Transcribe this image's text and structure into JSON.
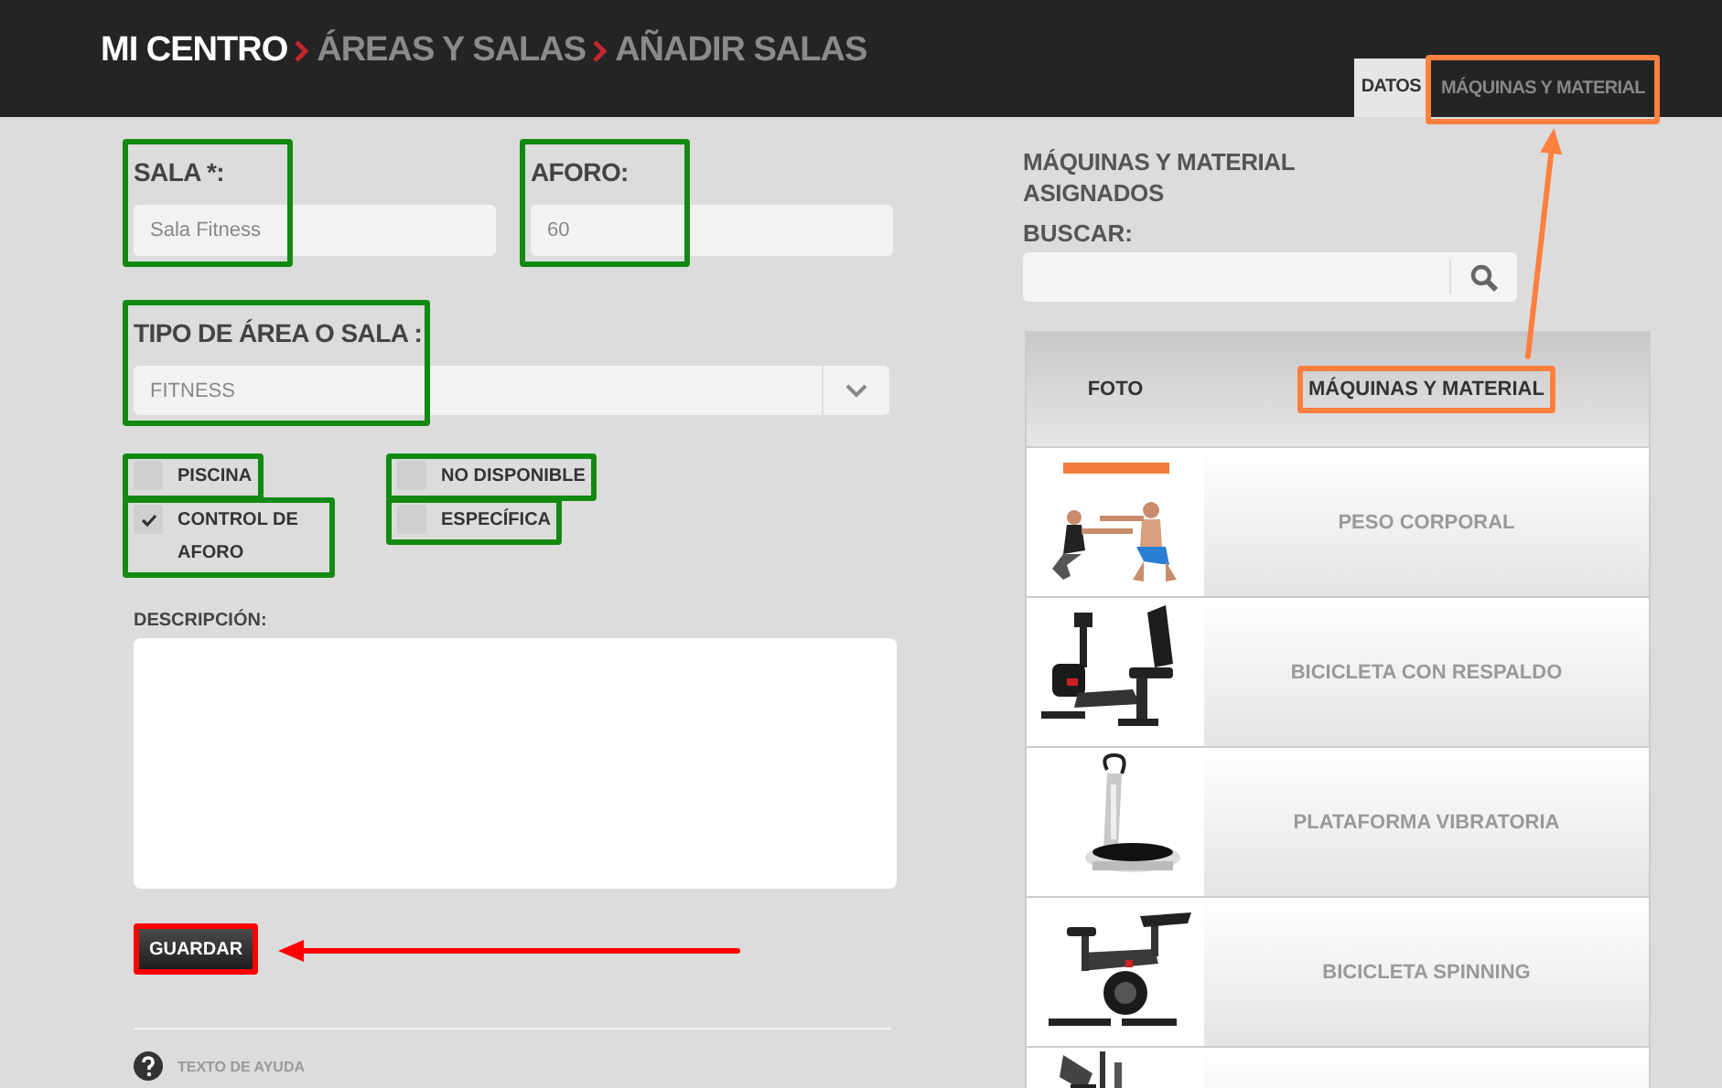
{
  "header": {
    "breadcrumb": [
      "MI CENTRO",
      "ÁREAS Y SALAS",
      "AÑADIR SALAS"
    ],
    "tabs": [
      {
        "label": "DATOS",
        "selected": true,
        "highlighted": false
      },
      {
        "label": "MÁQUINAS Y MATERIAL",
        "selected": false,
        "highlighted": true
      }
    ]
  },
  "form": {
    "fields": [
      {
        "kind": "text",
        "label": "SALA *:",
        "value": "Sala Fitness",
        "highlighted": true
      },
      {
        "kind": "text",
        "label": "AFORO:",
        "value": "60",
        "highlighted": true
      },
      {
        "kind": "select",
        "label": "TIPO DE ÁREA O SALA :",
        "value": "FITNESS",
        "highlighted": true
      }
    ],
    "checkboxes": [
      {
        "label": "PISCINA",
        "checked": false,
        "highlighted": true
      },
      {
        "label": "NO DISPONIBLE",
        "checked": false,
        "highlighted": true
      },
      {
        "label": "CONTROL DE AFORO",
        "checked": true,
        "highlighted": true
      },
      {
        "label": "ESPECÍFICA",
        "checked": false,
        "highlighted": true
      }
    ],
    "description": {
      "label": "DESCRIPCIÓN:"
    },
    "save_button": {
      "label": "GUARDAR",
      "highlighted": true,
      "arrow": true
    },
    "help": {
      "label": "TEXTO DE AYUDA"
    }
  },
  "equipment": {
    "title": "MÁQUINAS Y MATERIAL ASIGNADOS",
    "search_label": "BUSCAR:",
    "header_arrow": true,
    "columns": [
      {
        "label": "FOTO",
        "highlighted": false
      },
      {
        "label": "MÁQUINAS Y MATERIAL",
        "highlighted": true
      }
    ],
    "rows": [
      {
        "kind": "item",
        "name": "PESO CORPORAL"
      },
      {
        "kind": "item",
        "name": "BICICLETA CON RESPALDO"
      },
      {
        "kind": "item",
        "name": "PLATAFORMA VIBRATORIA"
      },
      {
        "kind": "item",
        "name": "BICICLETA SPINNING"
      },
      {
        "kind": "cut"
      }
    ]
  }
}
